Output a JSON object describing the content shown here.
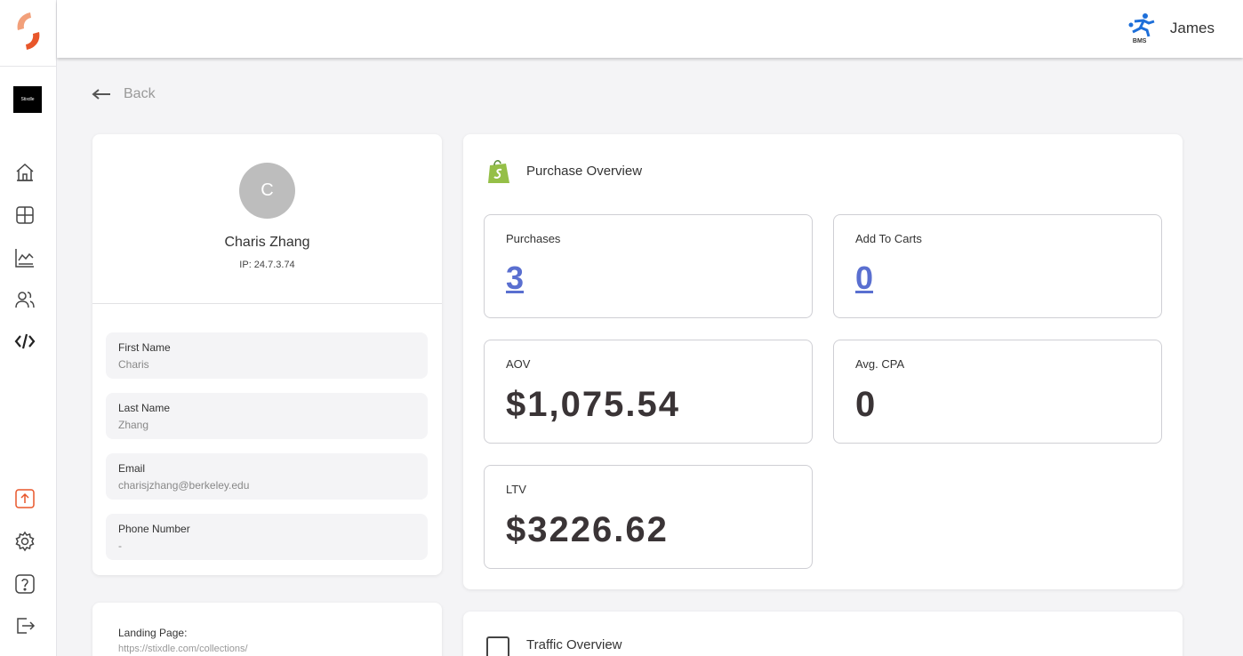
{
  "sidebar": {
    "brand_thumb_label": "Stixdle",
    "nav_icons": [
      "home-icon",
      "grid-icon",
      "chart-icon",
      "users-icon",
      "code-icon"
    ],
    "bottom_icons": [
      "upload-icon",
      "settings-icon",
      "help-icon",
      "logout-icon"
    ],
    "accent_color": "#e8562a"
  },
  "topbar": {
    "user_logo_text": "BMS",
    "user_name": "James"
  },
  "back_label": "Back",
  "profile": {
    "avatar_initial": "C",
    "name": "Charis Zhang",
    "ip": "IP: 24.7.3.74",
    "fields": [
      {
        "label": "First Name",
        "value": "Charis"
      },
      {
        "label": "Last Name",
        "value": "Zhang"
      },
      {
        "label": "Email",
        "value": "charisjzhang@berkeley.edu"
      },
      {
        "label": "Phone Number",
        "value": "-"
      }
    ]
  },
  "landing": {
    "label": "Landing Page:",
    "url": "https://stixdle.com/collections/"
  },
  "purchase_overview": {
    "title": "Purchase Overview",
    "metrics": [
      {
        "label": "Purchases",
        "value": "3"
      },
      {
        "label": "Add To Carts",
        "value": "0"
      },
      {
        "label": "AOV",
        "value": "$1,075.54"
      },
      {
        "label": "Avg. CPA",
        "value": "0"
      },
      {
        "label": "LTV",
        "value": "$3226.62"
      }
    ],
    "link_color": "#5a6fd0"
  },
  "traffic_overview": {
    "title": "Traffic Overview"
  }
}
